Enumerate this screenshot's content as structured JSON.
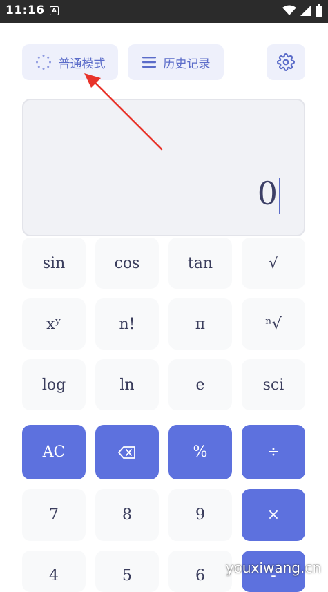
{
  "status_bar": {
    "time": "11:16",
    "notification_icon_letter": "A"
  },
  "toolbar": {
    "mode_label": "普通模式",
    "history_label": "历史记录",
    "settings_icon": "gear-icon"
  },
  "display": {
    "value": "0"
  },
  "keys": {
    "sin": "sin",
    "cos": "cos",
    "tan": "tan",
    "sqrt": "√",
    "power": "xʸ",
    "factorial": "n!",
    "pi": "π",
    "nth_root": "ⁿ√",
    "log": "log",
    "ln": "ln",
    "e": "e",
    "sci": "sci",
    "clear": "AC",
    "percent": "%",
    "divide": "÷",
    "seven": "7",
    "eight": "8",
    "nine": "9",
    "multiply": "×",
    "four": "4",
    "five": "5",
    "six": "6",
    "minus": "-"
  },
  "watermark": "youxiwang.cn",
  "colors": {
    "accent": "#5d71de",
    "light_key": "#f8f9fa",
    "display_bg": "#f1f2f6",
    "arrow": "#e8332a"
  }
}
